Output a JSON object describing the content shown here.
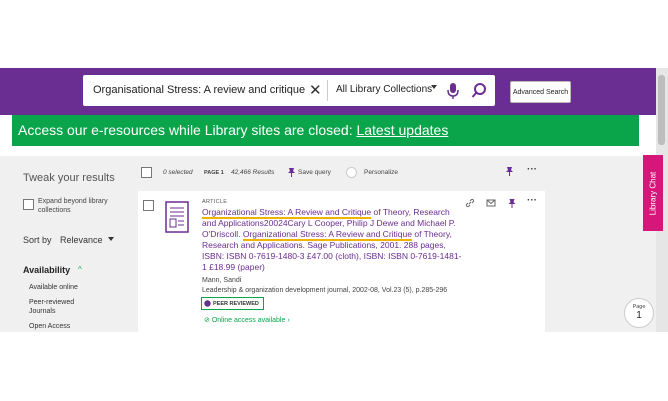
{
  "search": {
    "query": "Organisational Stress: A review and critique",
    "scope": "All Library Collections",
    "advanced_label": "Advanced Search"
  },
  "banner": {
    "text": "Access our e-resources while Library sites are closed: ",
    "link": "Latest updates"
  },
  "sidebar": {
    "heading": "Tweak your results",
    "expand_label": "Expand beyond library collections",
    "sort_label": "Sort by",
    "sort_value": "Relevance",
    "availability_label": "Availability",
    "facets": [
      "Available online",
      "Peer-reviewed Journals",
      "Open Access"
    ]
  },
  "toolbar": {
    "selected": "0 selected",
    "page": "PAGE 1",
    "results": "42,466 Results",
    "save_query": "Save query",
    "personalize": "Personalize"
  },
  "result": {
    "type": "ARTICLE",
    "title_hl": "Organizational Stress: A Review and Critique",
    "title_rest1": " of Theory, Research and Applications20024Cary L Cooper, Philip J Dewe and Michael P. O'Driscoll. ",
    "title_hl2": "Organizational Stress: A Review and Critique",
    "title_rest2": " of Theory, Research and Applications. Sage Publications, 2001. 288 pages, ISBN: ISBN 0-7619-1480-3 £47.00 (cloth), ISBN: ISBN 0-7619-1481-1 £18.99 (paper)",
    "author": "Mann, Sandi",
    "journal": "Leadership & organization development journal, 2002-08, Vol.23 (5), p.285-296",
    "peer_badge": "PEER REVIEWED",
    "online": "Online access available"
  },
  "library_chat": "Library Chat",
  "page_indicator": {
    "label": "Page",
    "number": "1"
  },
  "colors": {
    "header": "#6a2d91",
    "banner": "#0aa54a",
    "chat": "#d5177a"
  }
}
